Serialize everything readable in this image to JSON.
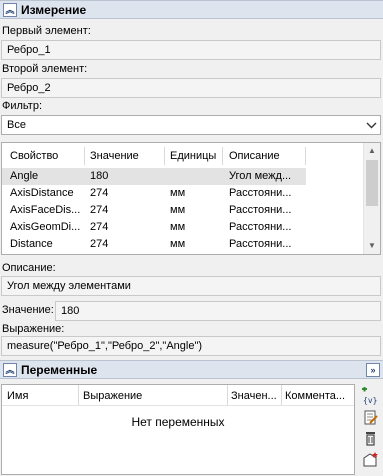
{
  "measure_panel": {
    "title": "Измерение",
    "first_element_label": "Первый элемент:",
    "first_element_value": "Ребро_1",
    "second_element_label": "Второй элемент:",
    "second_element_value": "Ребро_2",
    "filter_label": "Фильтр:",
    "filter_value": "Все",
    "table": {
      "columns": [
        "Свойство",
        "Значение",
        "Единицы",
        "Описание"
      ],
      "rows": [
        {
          "property": "Angle",
          "value": "180",
          "units": "",
          "description": "Угол межд..."
        },
        {
          "property": "AxisDistance",
          "value": "274",
          "units": "мм",
          "description": "Расстояни..."
        },
        {
          "property": "AxisFaceDis...",
          "value": "274",
          "units": "мм",
          "description": "Расстояни..."
        },
        {
          "property": "AxisGeomDi...",
          "value": "274",
          "units": "мм",
          "description": "Расстояни..."
        },
        {
          "property": "Distance",
          "value": "274",
          "units": "мм",
          "description": "Расстояни..."
        }
      ]
    },
    "description_label": "Описание:",
    "description_value": "Угол между элементами",
    "value_label": "Значение:",
    "value_value": "180",
    "expression_label": "Выражение:",
    "expression_value": "measure(\"Ребро_1\",\"Ребро_2\",\"Angle\")"
  },
  "variables_panel": {
    "title": "Переменные",
    "columns": [
      "Имя",
      "Выражение",
      "Значен...",
      "Коммента..."
    ],
    "empty_text": "Нет переменных",
    "side_buttons": [
      {
        "name": "add-variable-icon",
        "label": "{v}"
      },
      {
        "name": "edit-variable-icon"
      },
      {
        "name": "delete-variable-icon"
      },
      {
        "name": "add-from-measure-icon"
      }
    ]
  },
  "colors": {
    "header_bg": "#dde4ee",
    "accent": "#1f3f74",
    "selected_row": "#e3e3e3"
  },
  "icons": {
    "collapse": "chevron-double-up",
    "expand": "chevron-double-right",
    "dropdown": "chevron-down"
  }
}
